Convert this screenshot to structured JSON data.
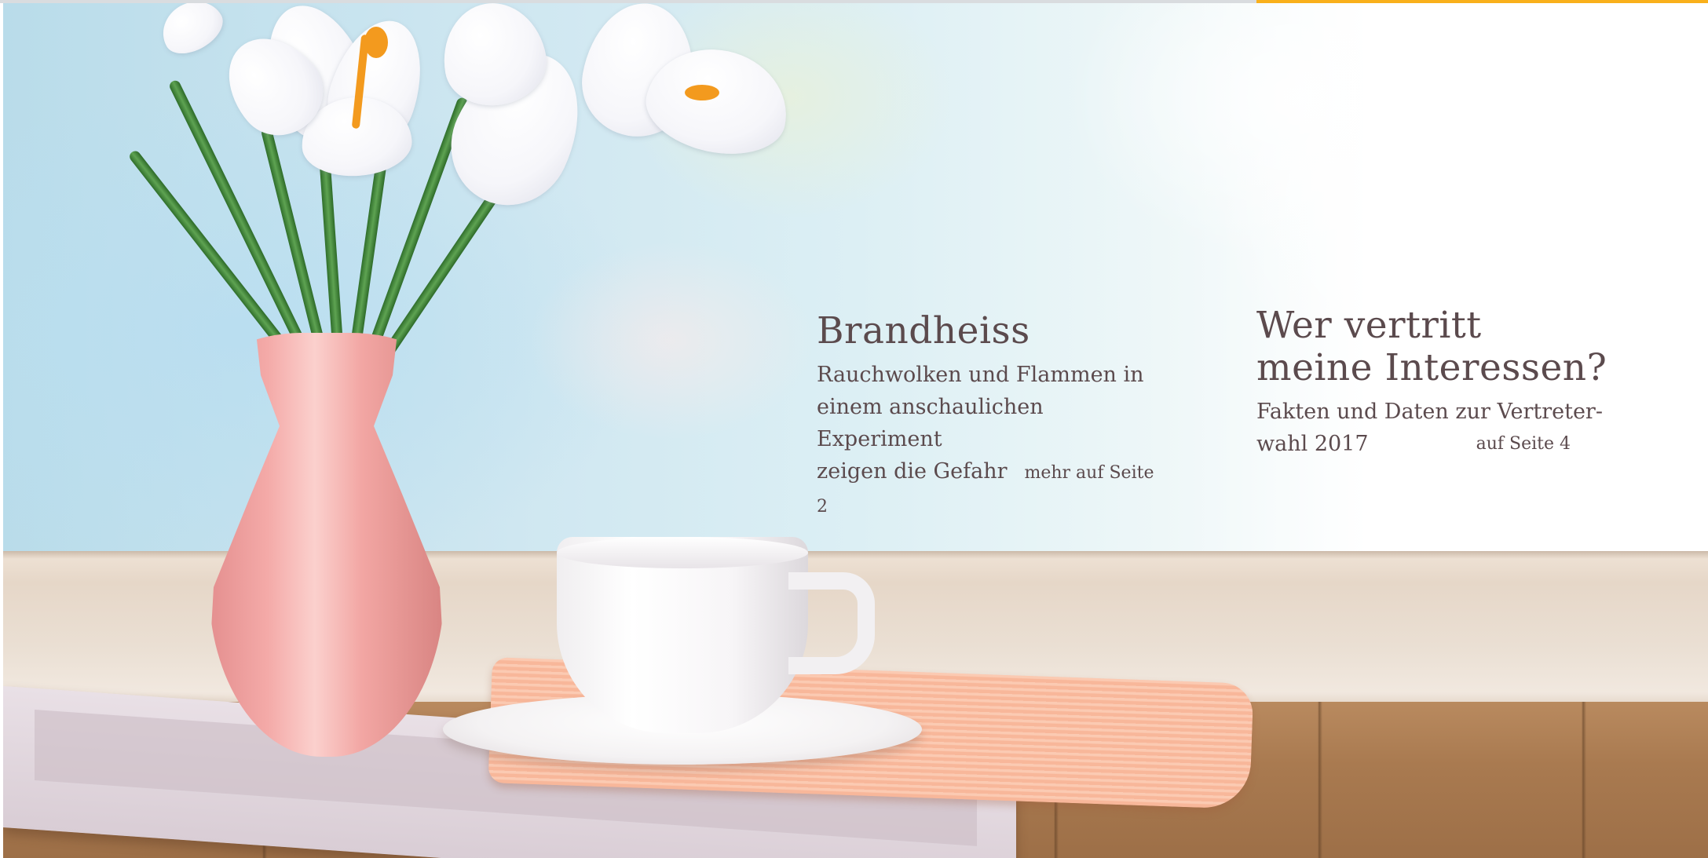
{
  "colors": {
    "accent": "#f9b01b",
    "text": "#5b4a4d",
    "top_rule": "#d9dcdf"
  },
  "photo": {
    "icon": "crocus-vase-teacup-photo-icon"
  },
  "articles": [
    {
      "headline": "Brandheiss",
      "teaser_lines": [
        "Rauchwolken und Flammen in",
        "einem anschaulichen Experiment",
        "zeigen die Gefahr"
      ],
      "page_ref": "mehr auf Seite 2"
    },
    {
      "headline_lines": [
        "Wer vertritt",
        "meine Interessen?"
      ],
      "teaser_lines": [
        "Fakten und Daten zur Vertreter-",
        "wahl 2017"
      ],
      "page_ref": "auf Seite 4"
    }
  ]
}
